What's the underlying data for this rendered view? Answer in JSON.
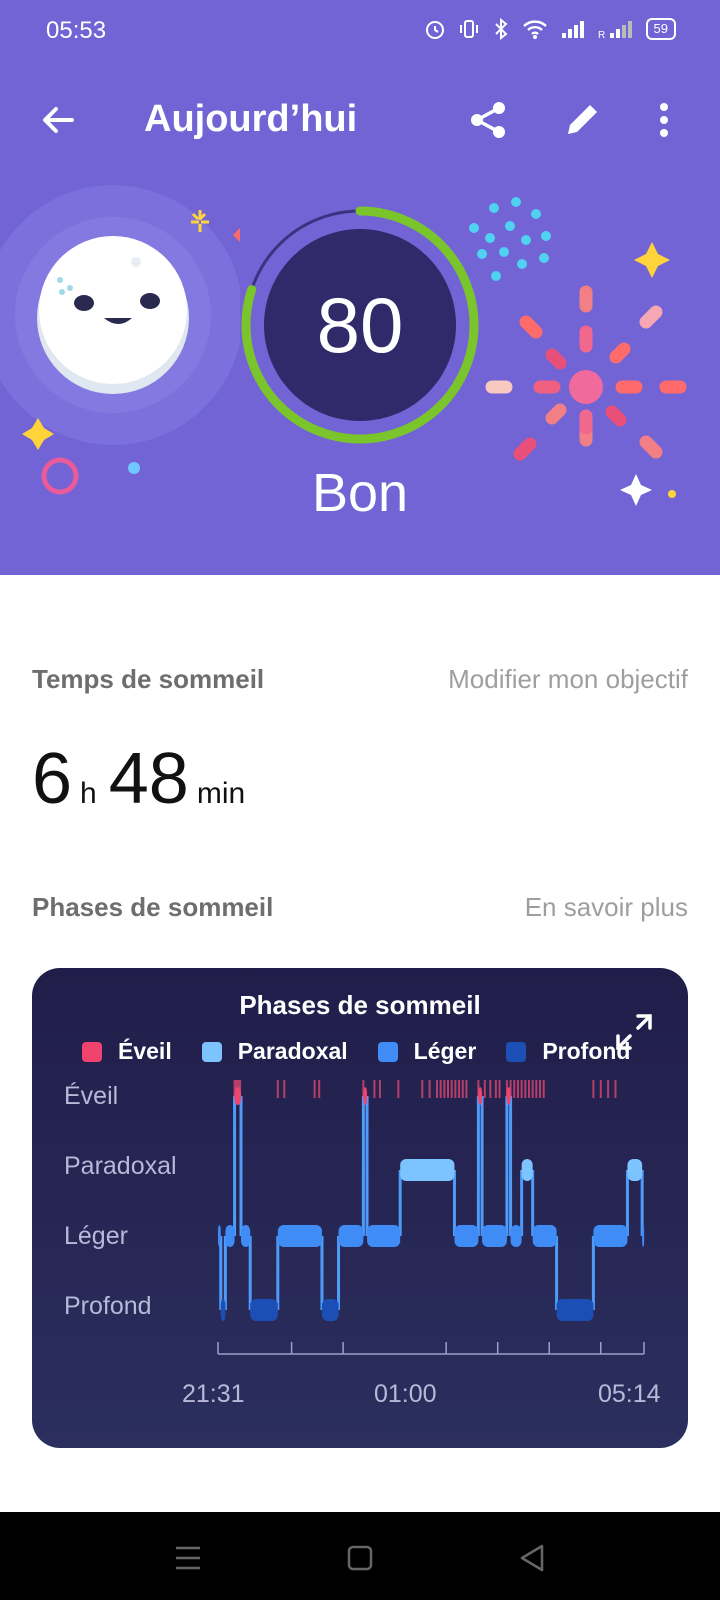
{
  "status": {
    "time": "05:53",
    "battery": "59"
  },
  "appbar": {
    "title": "Aujourd’hui"
  },
  "score": {
    "value": 80,
    "max": 100,
    "label": "Bon",
    "ring_color": "#7bc52c"
  },
  "sleep_time": {
    "title": "Temps de sommeil",
    "link": "Modifier mon objectif",
    "hours": "6",
    "hours_unit": "h",
    "minutes": "48",
    "minutes_unit": "min"
  },
  "phases": {
    "title": "Phases de sommeil",
    "link": "En savoir plus"
  },
  "chart_data": {
    "type": "line",
    "title": "Phases de sommeil",
    "legend": [
      {
        "name": "Éveil",
        "color": "#f0436e"
      },
      {
        "name": "Paradoxal",
        "color": "#7cc3ff"
      },
      {
        "name": "Léger",
        "color": "#3f8cf6"
      },
      {
        "name": "Profond",
        "color": "#1c4fb5"
      }
    ],
    "y_categories": [
      "Éveil",
      "Paradoxal",
      "Léger",
      "Profond"
    ],
    "x_tick_labels": [
      "21:31",
      "01:00",
      "05:14"
    ],
    "x_range_minutes": [
      0,
      463
    ],
    "segments": [
      {
        "start": 0,
        "end": 3,
        "stage": "Léger"
      },
      {
        "start": 3,
        "end": 8,
        "stage": "Profond"
      },
      {
        "start": 8,
        "end": 18,
        "stage": "Léger"
      },
      {
        "start": 18,
        "end": 25,
        "stage": "Éveil"
      },
      {
        "start": 25,
        "end": 35,
        "stage": "Léger"
      },
      {
        "start": 35,
        "end": 65,
        "stage": "Profond"
      },
      {
        "start": 65,
        "end": 113,
        "stage": "Léger"
      },
      {
        "start": 113,
        "end": 131,
        "stage": "Profond"
      },
      {
        "start": 131,
        "end": 158,
        "stage": "Léger"
      },
      {
        "start": 158,
        "end": 162,
        "stage": "Éveil"
      },
      {
        "start": 162,
        "end": 198,
        "stage": "Léger"
      },
      {
        "start": 198,
        "end": 257,
        "stage": "Paradoxal"
      },
      {
        "start": 257,
        "end": 283,
        "stage": "Léger"
      },
      {
        "start": 283,
        "end": 287,
        "stage": "Éveil"
      },
      {
        "start": 287,
        "end": 314,
        "stage": "Léger"
      },
      {
        "start": 314,
        "end": 318,
        "stage": "Éveil"
      },
      {
        "start": 318,
        "end": 330,
        "stage": "Léger"
      },
      {
        "start": 330,
        "end": 342,
        "stage": "Paradoxal"
      },
      {
        "start": 342,
        "end": 368,
        "stage": "Léger"
      },
      {
        "start": 368,
        "end": 408,
        "stage": "Profond"
      },
      {
        "start": 408,
        "end": 445,
        "stage": "Léger"
      },
      {
        "start": 445,
        "end": 461,
        "stage": "Paradoxal"
      },
      {
        "start": 461,
        "end": 463,
        "stage": "Léger"
      }
    ],
    "wake_ticks_minutes": [
      18,
      20,
      22,
      24,
      65,
      72,
      105,
      110,
      158,
      170,
      176,
      196,
      222,
      230,
      238,
      242,
      246,
      250,
      254,
      258,
      262,
      266,
      270,
      283,
      290,
      296,
      302,
      306,
      314,
      318,
      322,
      326,
      330,
      334,
      338,
      342,
      346,
      350,
      354,
      408,
      416,
      424,
      432
    ]
  }
}
